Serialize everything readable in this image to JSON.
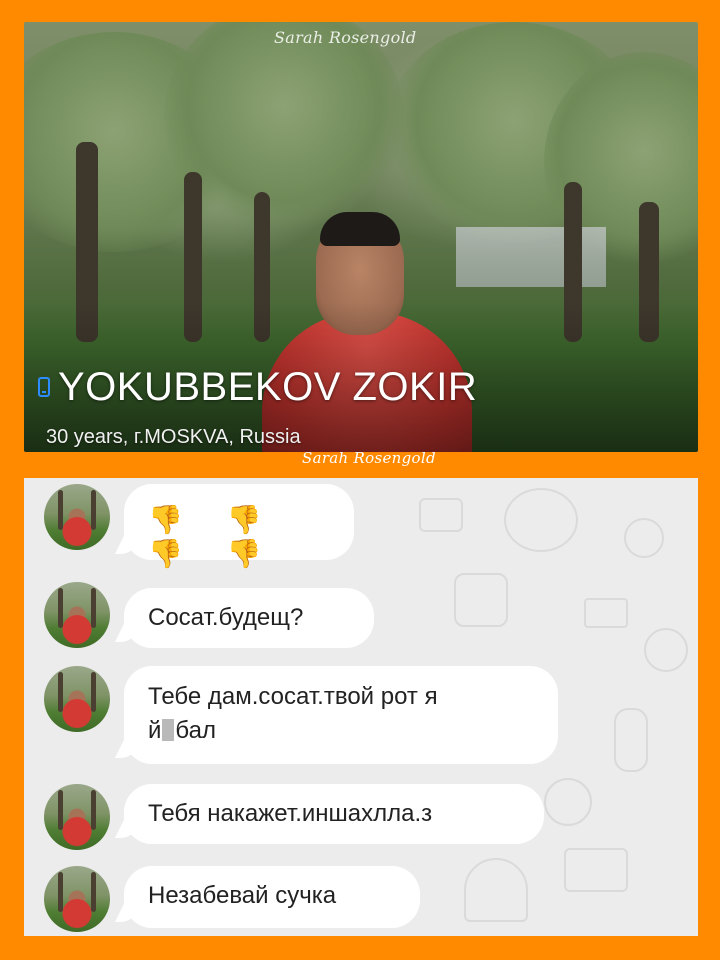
{
  "profile": {
    "watermark_top": "Sarah Rosengold",
    "name": "YOKUBBEKOV ZOKIR",
    "details": "30 years, г.MOSKVA, Russia",
    "icon": "phone-icon",
    "icon_color": "#2d8cff"
  },
  "watermark_mid": "Sarah Rosengold",
  "chat": {
    "messages": [
      {
        "text": "👎 👎 👎 👎"
      },
      {
        "text": "Сосат.будещ?"
      },
      {
        "line1": "Тебе дам.сосат.твой рот я",
        "line2_a": "й",
        "line2_b": "бал"
      },
      {
        "text": "Тебя накажет.иншахлла.з"
      },
      {
        "text": "Незабевай сучка"
      }
    ]
  },
  "colors": {
    "frame": "#ff8a00",
    "chat_bg": "#ececec",
    "bubble": "#ffffff"
  }
}
